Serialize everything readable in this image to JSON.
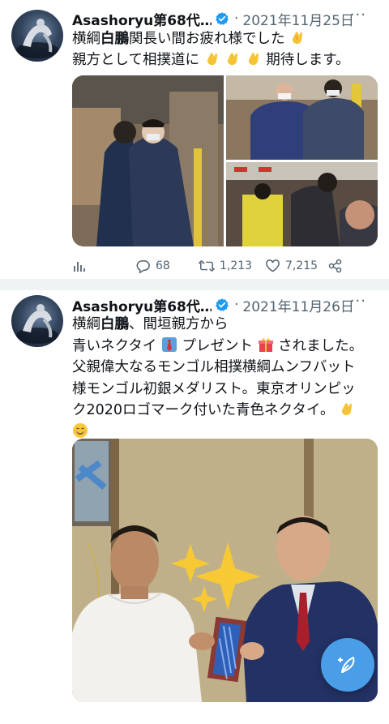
{
  "tweets": [
    {
      "author": "Asashoryu第68代…",
      "dot": "·",
      "date": "2021年11月25日",
      "more": "···",
      "line1_a": "横綱",
      "line1_bold": "白鵬",
      "line1_b": "関長い間お疲れ様でした",
      "line2_a": "親方として相撲道に",
      "line2_b": "期待します。",
      "stats": {
        "replies": "68",
        "retweets": "1,213",
        "likes": "7,215"
      }
    },
    {
      "author": "Asashoryu第68代…",
      "dot": "·",
      "date": "2021年11月26日",
      "more": "···",
      "line1_a": "横綱",
      "line1_bold": "白鵬",
      "line1_b": "、間垣親方から",
      "line2_a": "青いネクタイ",
      "line2_b": "プレゼント",
      "line2_c": "されました。",
      "line3": "父親偉大なるモンゴル相撲横綱ムンフバット",
      "line4": "様モンゴル初銀メダリスト。東京オリンピッ",
      "line5": "ク2020ロゴマーク付いた青色ネクタイ。"
    }
  ],
  "icons": {
    "verified": "verified-badge-icon",
    "analytics": "analytics-icon",
    "reply": "reply-icon",
    "retweet": "retweet-icon",
    "like": "heart-icon",
    "share": "share-icon",
    "compose": "compose-tweet-icon",
    "clap": "clapping-hands-emoji",
    "tie": "necktie-emoji",
    "gift": "gift-emoji",
    "smile": "smiling-face-emoji",
    "sparkles": "sparkles-emoji"
  },
  "colors": {
    "accent": "#1d9bf0",
    "fab": "#4a9ee8",
    "muted": "#536471",
    "divider": "#eff3f4"
  }
}
